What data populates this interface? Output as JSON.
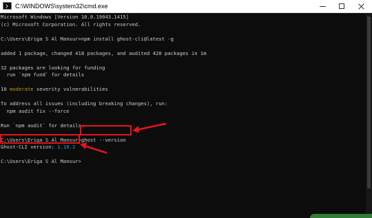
{
  "window": {
    "title": "C:\\WINDOWS\\system32\\cmd.exe",
    "icon": "cmd-icon"
  },
  "console": {
    "lines": [
      {
        "text": "Microsoft Windows [Version 10.0.19043.1415]"
      },
      {
        "text": "(c) Microsoft Corporation. All rights reserved."
      },
      {
        "text": ""
      },
      {
        "text": "C:\\Users\\Eriga S Al Mansur>npm install ghost-cli@latest -g"
      },
      {
        "text": ""
      },
      {
        "text": "added 1 package, changed 418 packages, and audited 420 packages in 1m"
      },
      {
        "text": ""
      },
      {
        "text": "32 packages are looking for funding"
      },
      {
        "text": "  run `npm fund` for details"
      },
      {
        "text": ""
      },
      {
        "pre": "10 ",
        "highlight": "moderate",
        "post": " severity vulnerabilities",
        "highlight_color": "#c19c00"
      },
      {
        "text": ""
      },
      {
        "text": "To address all issues (including breaking changes), run:"
      },
      {
        "text": "  npm audit fix --force"
      },
      {
        "text": ""
      },
      {
        "text": "Run `npm audit` for details."
      },
      {
        "text": ""
      },
      {
        "text": "C:\\Users\\Eriga S Al Mansur>ghost --version"
      },
      {
        "pre": "Ghost-CLI version: ",
        "highlight": "1.18.1",
        "post": "",
        "highlight_color": "#3a96dd"
      },
      {
        "text": ""
      },
      {
        "text": "C:\\Users\\Eriga S Al Mansur>"
      }
    ]
  },
  "annotations": {
    "box_color": "#e8141b",
    "arrow_color": "#e8141b"
  },
  "colors": {
    "console_bg": "#0c0c0c",
    "console_fg": "#cccccc",
    "yellow": "#c19c00",
    "cyan": "#3a96dd"
  }
}
